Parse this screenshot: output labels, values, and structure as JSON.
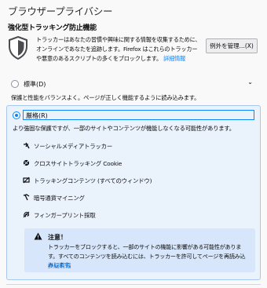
{
  "header": {
    "title": "ブラウザープライバシー",
    "subtitle": "強化型トラッキング防止機能"
  },
  "etp": {
    "description": "トラッカーはあなたの習慣や興味に関する情報を収集するために、オンラインであなたを追跡します。Firefox はこれらのトラッカーや悪意のあるスクリプトの多くをブロックします。",
    "learn_more": "詳細情報",
    "exceptions_button": "例外を管理...(X)"
  },
  "options": {
    "standard": {
      "label": "標準(D)",
      "description": "保護と性能をバランスよく。ページが正しく機能するように読み込みます。",
      "selected": false
    },
    "strict": {
      "label": "厳格(R)",
      "description": "より強固な保護ですが、一部のサイトやコンテンツが機能しなくなる可能性があります。",
      "selected": true,
      "items": [
        {
          "label": "ソーシャルメディアトラッカー",
          "icon": "social-tracker-icon"
        },
        {
          "label": "クロスサイトトラッキング Cookie",
          "icon": "cookie-icon"
        },
        {
          "label": "トラッキングコンテンツ (すべてのウィンドウ)",
          "icon": "tracking-content-icon"
        },
        {
          "label": "暗号通貨マイニング",
          "icon": "cryptominer-icon"
        },
        {
          "label": "フィンガープリント採取",
          "icon": "fingerprint-icon"
        }
      ],
      "warning": {
        "title": "注意！",
        "body": "トラッカーをブロックすると、一部のサイトの機能に影響がある可能性があります。すべてのコンテンツを読み込むには、トラッカーを許可してページを再読み込みします。",
        "link": "詳細情報"
      }
    }
  },
  "colors": {
    "accent": "#0a84ff",
    "strict_bg": "#eaf2fc",
    "warning_bg": "#d7e6fa"
  }
}
